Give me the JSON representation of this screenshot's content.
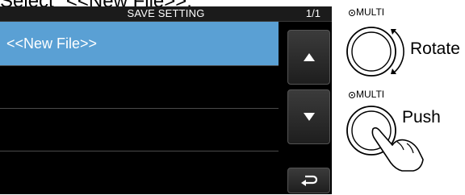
{
  "caption": "Select \"<<New File>>.\"",
  "screen": {
    "title": "SAVE SETTING",
    "page": "1/1",
    "items": [
      {
        "label": "<<New File>>",
        "selected": true
      },
      {
        "label": ""
      },
      {
        "label": ""
      },
      {
        "label": ""
      }
    ],
    "buttons": {
      "up": "up-arrow-icon",
      "down": "down-arrow-icon",
      "back": "return-arrow-icon"
    }
  },
  "knobs": {
    "rotate": {
      "label": "MULTI",
      "action": "Rotate"
    },
    "push": {
      "label": "MULTI",
      "action": "Push"
    }
  },
  "colors": {
    "selected_row": "#5aa0d4",
    "screen_bg": "#000000"
  }
}
